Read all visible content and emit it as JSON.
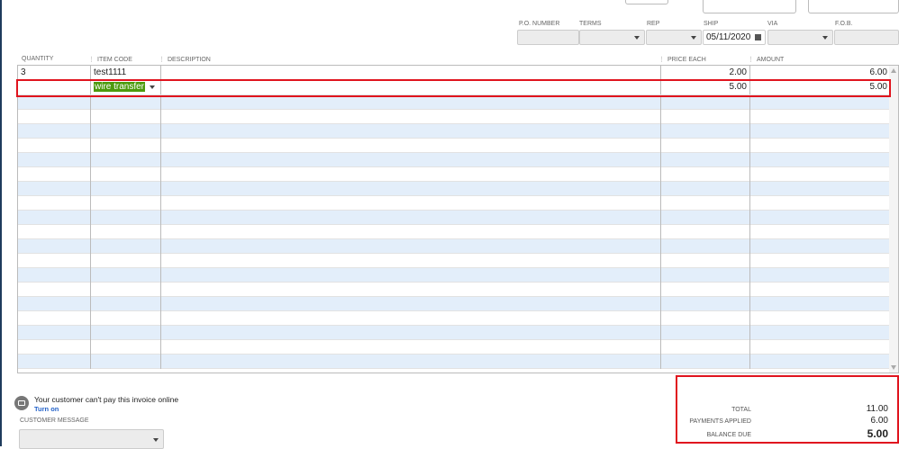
{
  "header_fields": {
    "po_number": {
      "label": "P.O. NUMBER",
      "value": ""
    },
    "terms": {
      "label": "TERMS",
      "value": ""
    },
    "rep": {
      "label": "REP",
      "value": ""
    },
    "ship": {
      "label": "SHIP",
      "value": "05/11/2020"
    },
    "via": {
      "label": "VIA",
      "value": ""
    },
    "fob": {
      "label": "F.O.B.",
      "value": ""
    }
  },
  "columns": [
    "QUANTITY",
    "ITEM CODE",
    "DESCRIPTION",
    "PRICE EACH",
    "AMOUNT"
  ],
  "rows": [
    {
      "quantity": "3",
      "item_code": "test1111",
      "description": "",
      "price_each": "2.00",
      "amount": "6.00"
    },
    {
      "quantity": "",
      "item_code": "wire transfer",
      "description": "",
      "price_each": "5.00",
      "amount": "5.00"
    }
  ],
  "payment_notice": {
    "text": "Your customer can't pay this invoice online",
    "link": "Turn on"
  },
  "customer_message": {
    "label": "CUSTOMER MESSAGE",
    "value": ""
  },
  "totals": {
    "total_label": "TOTAL",
    "total": "11.00",
    "payments_label": "PAYMENTS APPLIED",
    "payments": "6.00",
    "balance_label": "BALANCE DUE",
    "balance": "5.00"
  }
}
